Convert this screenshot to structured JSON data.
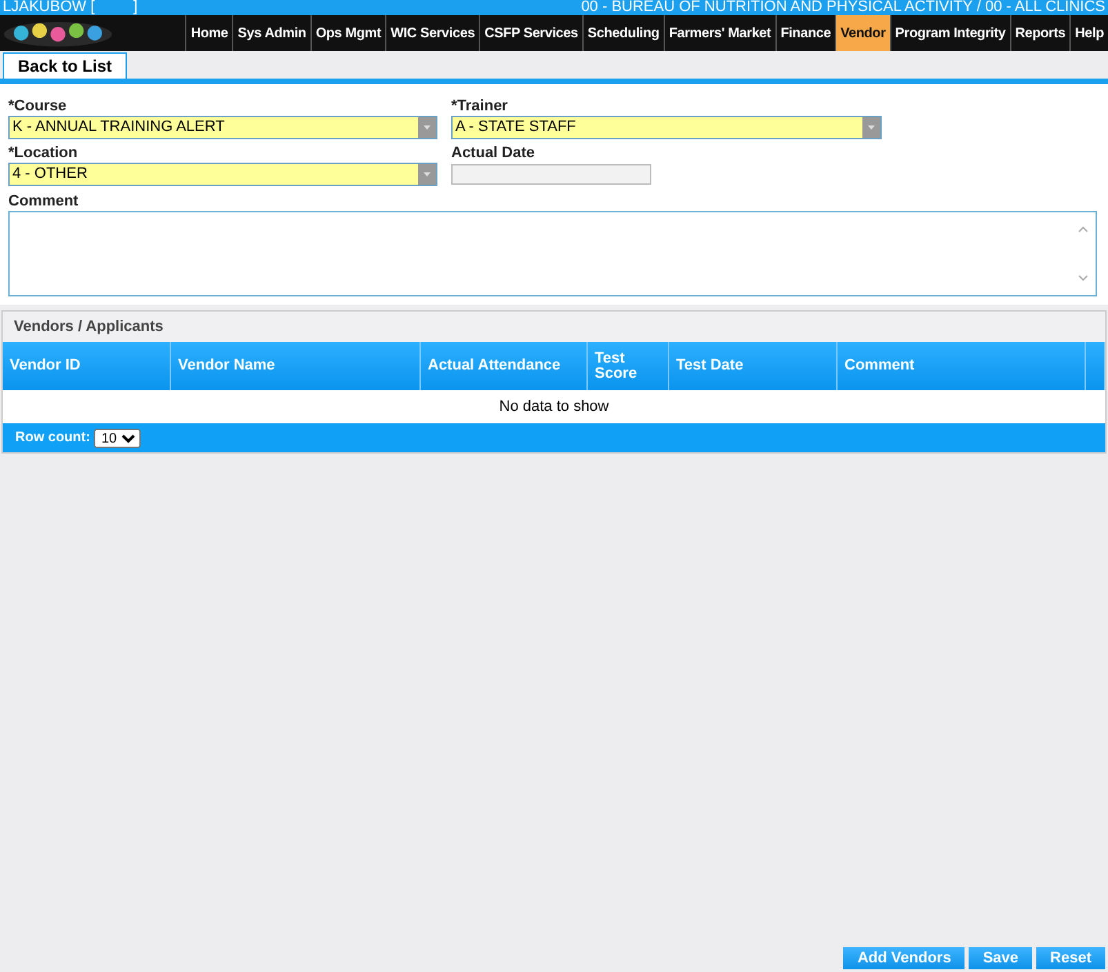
{
  "top_bar": {
    "user": "LJAKUBOW [",
    "user_suffix": "]",
    "agency": "00 - BUREAU OF NUTRITION AND PHYSICAL ACTIVITY / 00 - ALL CLINICS"
  },
  "nav": [
    {
      "label": "Home",
      "selected": false
    },
    {
      "label": "Sys Admin",
      "selected": false
    },
    {
      "label": "Ops Mgmt",
      "selected": false
    },
    {
      "label": "WIC Services",
      "selected": false
    },
    {
      "label": "CSFP Services",
      "selected": false
    },
    {
      "label": "Scheduling",
      "selected": false
    },
    {
      "label": "Farmers' Market",
      "selected": false
    },
    {
      "label": "Finance",
      "selected": false
    },
    {
      "label": "Vendor",
      "selected": true
    },
    {
      "label": "Program Integrity",
      "selected": false
    },
    {
      "label": "Reports",
      "selected": false
    },
    {
      "label": "Help",
      "selected": false
    }
  ],
  "back_button": "Back to List",
  "form": {
    "course": {
      "label": "*Course",
      "value": "K - ANNUAL TRAINING ALERT"
    },
    "trainer": {
      "label": "*Trainer",
      "value": "A - STATE STAFF"
    },
    "location": {
      "label": "*Location",
      "value": "4 - OTHER"
    },
    "actual_date": {
      "label": "Actual Date",
      "disabled": true
    },
    "comment": {
      "label": "Comment"
    }
  },
  "vendors": {
    "title": "Vendors / Applicants",
    "columns": [
      "Vendor ID",
      "Vendor Name",
      "Actual Attendance",
      "Test Score",
      "Test Date",
      "Comment"
    ],
    "empty_text": "No data to show",
    "row_count_label": "Row count:",
    "row_count": "10"
  },
  "buttons": [
    "Add Vendors",
    "Save",
    "Reset"
  ]
}
